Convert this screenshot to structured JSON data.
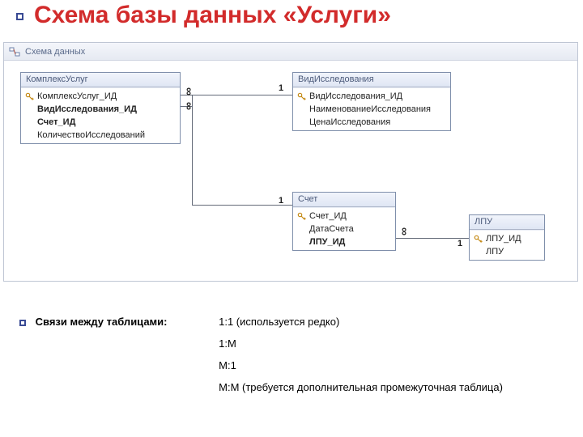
{
  "title": "Схема базы данных «Услуги»",
  "windowTitle": "Схема данных",
  "tables": {
    "t1": {
      "name": "КомплексУслуг",
      "fields": [
        {
          "name": "КомплексУслуг_ИД",
          "key": true,
          "bold": false
        },
        {
          "name": "ВидИсследования_ИД",
          "key": false,
          "bold": true
        },
        {
          "name": "Счет_ИД",
          "key": false,
          "bold": true
        },
        {
          "name": "КоличествоИсследований",
          "key": false,
          "bold": false
        }
      ]
    },
    "t2": {
      "name": "ВидИсследования",
      "fields": [
        {
          "name": "ВидИсследования_ИД",
          "key": true,
          "bold": false
        },
        {
          "name": "НаименованиеИсследования",
          "key": false,
          "bold": false
        },
        {
          "name": "ЦенаИсследования",
          "key": false,
          "bold": false
        }
      ]
    },
    "t3": {
      "name": "Счет",
      "fields": [
        {
          "name": "Счет_ИД",
          "key": true,
          "bold": false
        },
        {
          "name": "ДатаСчета",
          "key": false,
          "bold": false
        },
        {
          "name": "ЛПУ_ИД",
          "key": false,
          "bold": true
        }
      ]
    },
    "t4": {
      "name": "ЛПУ",
      "fields": [
        {
          "name": "ЛПУ_ИД",
          "key": true,
          "bold": false
        },
        {
          "name": "ЛПУ",
          "key": false,
          "bold": false
        }
      ]
    }
  },
  "cards": {
    "one12": "1",
    "inf12a": "∞",
    "inf12b": "∞",
    "one13": "1",
    "inf34": "∞",
    "one34": "1"
  },
  "footer": {
    "label": "Связи между таблицами:",
    "items": [
      "1:1 (используется редко)",
      "1:M",
      "M:1",
      "M:M (требуется дополнительная промежуточная таблица)"
    ]
  }
}
